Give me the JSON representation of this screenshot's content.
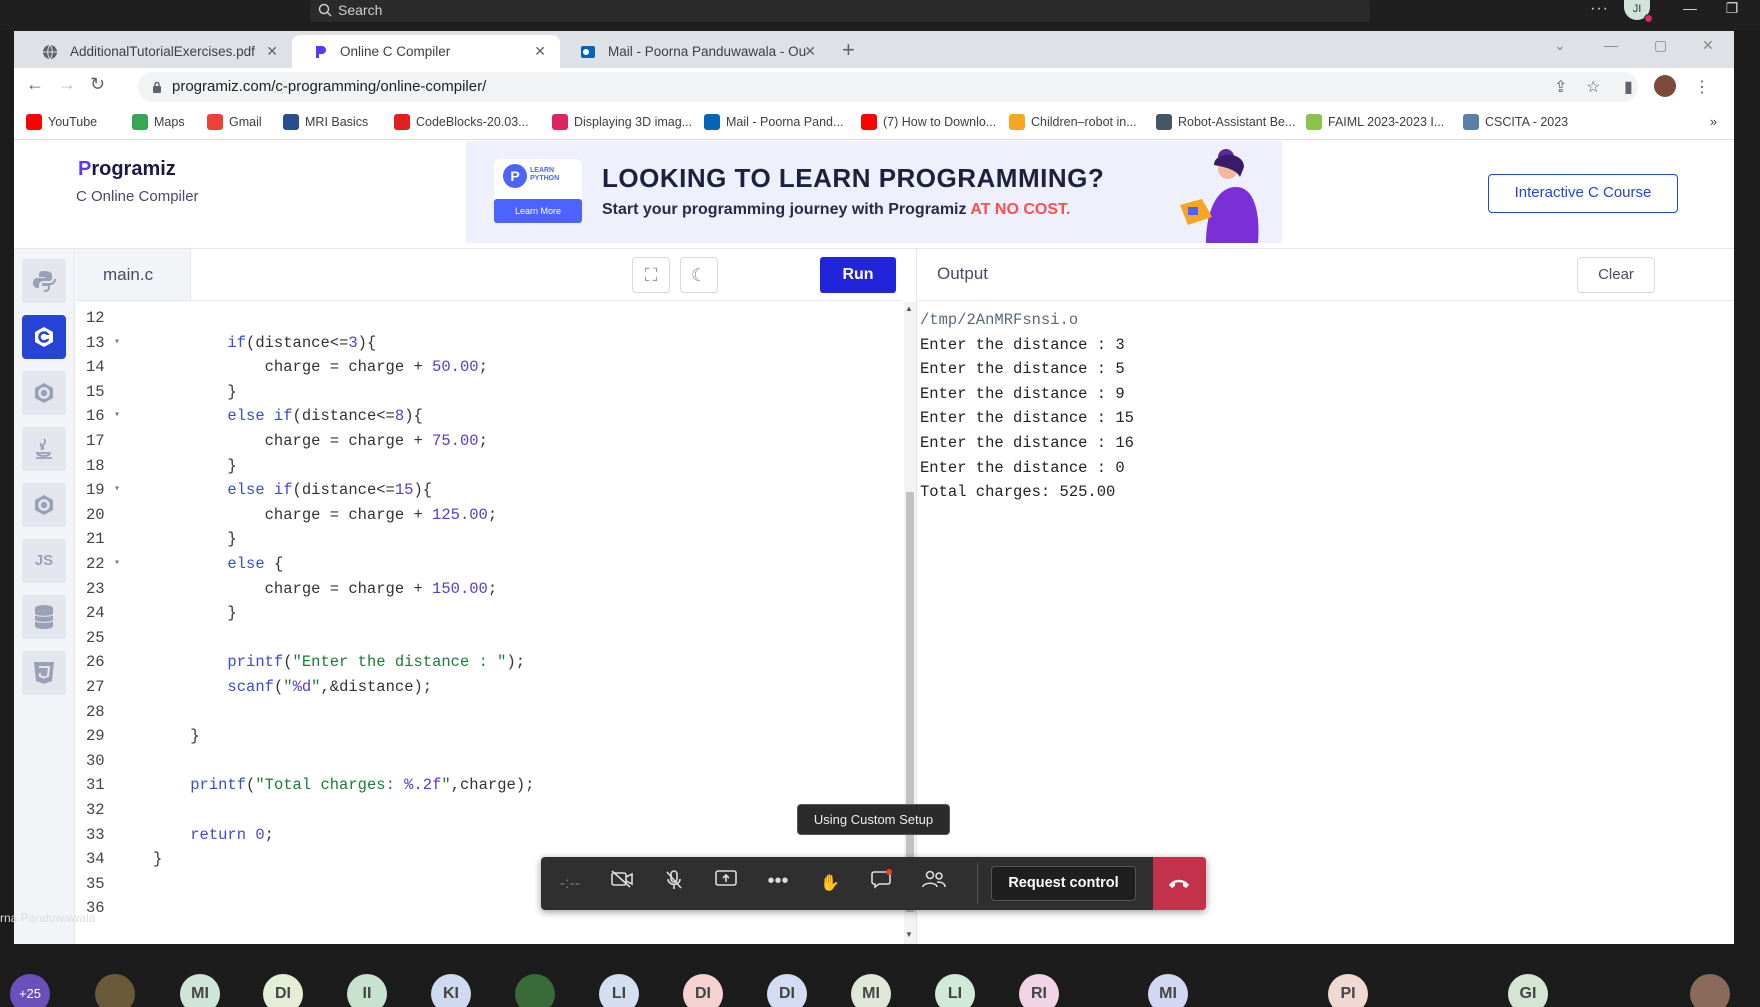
{
  "teams": {
    "search_placeholder": "Search",
    "more_label": "···",
    "user_initials": "JI"
  },
  "browser": {
    "tabs": [
      {
        "title": "AdditionalTutorialExercises.pdf",
        "close": "✕"
      },
      {
        "title": "Online C Compiler",
        "close": "✕"
      },
      {
        "title": "Mail - Poorna Panduwawala - Ou",
        "close": "✕"
      }
    ],
    "new_tab": "+",
    "url": "programiz.com/c-programming/online-compiler/",
    "bookmarks": [
      {
        "label": "YouTube",
        "color": "#ff0000"
      },
      {
        "label": "Maps",
        "color": "#34a853"
      },
      {
        "label": "Gmail",
        "color": "#ea4335"
      },
      {
        "label": "MRI Basics",
        "color": "#2a4d8f"
      },
      {
        "label": "CodeBlocks-20.03...",
        "color": "#e02020"
      },
      {
        "label": "Displaying 3D imag...",
        "color": "#e0245e"
      },
      {
        "label": "Mail - Poorna Pand...",
        "color": "#0364b8"
      },
      {
        "label": "(7) How to Downlo...",
        "color": "#ff0000"
      },
      {
        "label": "Children–robot in...",
        "color": "#f5a623"
      },
      {
        "label": "Robot-Assistant Be...",
        "color": "#445566"
      },
      {
        "label": "FAIML 2023-2023 I...",
        "color": "#8bc34a"
      },
      {
        "label": "CSCITA - 2023",
        "color": "#5b7fa8"
      }
    ],
    "bookmarks_more": "»"
  },
  "site": {
    "logo_p": "P",
    "logo_rest": "rogramiz",
    "subtitle": "C Online Compiler",
    "banner": {
      "tile_text_1": "LEARN",
      "tile_text_2": "PYTHON",
      "tile_button": "Learn More",
      "headline": "LOOKING TO LEARN PROGRAMMING?",
      "subline": "Start your programming journey with Programiz ",
      "subline_highlight": "AT NO COST."
    },
    "course_button": "Interactive C Course",
    "langs": [
      "py",
      "C",
      "C++",
      "Java",
      "C#",
      "JS",
      "SQL",
      "HTML"
    ]
  },
  "editor": {
    "file_tab": "main.c",
    "run_label": "Run",
    "lines": [
      {
        "n": "12",
        "f": "",
        "c": ""
      },
      {
        "n": "13",
        "f": "▾",
        "c": "        <span class='kw'>if</span>(distance&lt;=<span class='nm'>3</span>){"
      },
      {
        "n": "14",
        "f": "",
        "c": "            charge = charge + <span class='nm'>50.00</span>;"
      },
      {
        "n": "15",
        "f": "",
        "c": "        }"
      },
      {
        "n": "16",
        "f": "▾",
        "c": "        <span class='kw'>else if</span>(distance&lt;=<span class='nm'>8</span>){"
      },
      {
        "n": "17",
        "f": "",
        "c": "            charge = charge + <span class='nm'>75.00</span>;"
      },
      {
        "n": "18",
        "f": "",
        "c": "        }"
      },
      {
        "n": "19",
        "f": "▾",
        "c": "        <span class='kw'>else if</span>(distance&lt;=<span class='nm'>15</span>){"
      },
      {
        "n": "20",
        "f": "",
        "c": "            charge = charge + <span class='nm'>125.00</span>;"
      },
      {
        "n": "21",
        "f": "",
        "c": "        }"
      },
      {
        "n": "22",
        "f": "▾",
        "c": "        <span class='kw'>else</span> {"
      },
      {
        "n": "23",
        "f": "",
        "c": "            charge = charge + <span class='nm'>150.00</span>;"
      },
      {
        "n": "24",
        "f": "",
        "c": "        }"
      },
      {
        "n": "25",
        "f": "",
        "c": ""
      },
      {
        "n": "26",
        "f": "",
        "c": "        <span class='kw'>printf</span>(<span class='st'>\"Enter the distance : \"</span>);"
      },
      {
        "n": "27",
        "f": "",
        "c": "        <span class='kw'>scanf</span>(<span class='st'>\"<span class='nm'>%d</span>\"</span>,&amp;distance);"
      },
      {
        "n": "28",
        "f": "",
        "c": ""
      },
      {
        "n": "29",
        "f": "",
        "c": "    }"
      },
      {
        "n": "30",
        "f": "",
        "c": ""
      },
      {
        "n": "31",
        "f": "",
        "c": "    <span class='kw'>printf</span>(<span class='st'>\"Total charges: <span class='nm'>%.2f</span>\"</span>,charge);"
      },
      {
        "n": "32",
        "f": "",
        "c": ""
      },
      {
        "n": "33",
        "f": "",
        "c": "    <span class='kw'>return</span> <span class='nm'>0</span>;"
      },
      {
        "n": "34",
        "f": "",
        "c": "}"
      },
      {
        "n": "35",
        "f": "",
        "c": ""
      },
      {
        "n": "36",
        "f": "",
        "c": ""
      }
    ]
  },
  "output": {
    "title": "Output",
    "clear_label": "Clear",
    "lines": [
      "/tmp/2AnMRFsnsi.o",
      "Enter the distance : 3",
      "Enter the distance : 5",
      "Enter the distance : 9",
      "Enter the distance : 15",
      "Enter the distance : 16",
      "Enter the distance : 0",
      "Total charges: 525.00"
    ]
  },
  "call": {
    "tooltip": "Using Custom Setup",
    "request_control": "Request control",
    "speaker_name": "rna Panduwawala",
    "more_count": "+25",
    "participants": [
      {
        "initials": "",
        "color": "#6b5a3a"
      },
      {
        "initials": "MI",
        "color": "#cfe5d9"
      },
      {
        "initials": "DI",
        "color": "#e4edd5"
      },
      {
        "initials": "II",
        "color": "#c7e3cf"
      },
      {
        "initials": "KI",
        "color": "#cfd9ef"
      },
      {
        "initials": "",
        "color": "#3a6a3a"
      },
      {
        "initials": "LI",
        "color": "#d3dff0"
      },
      {
        "initials": "DI",
        "color": "#f4d2d2"
      },
      {
        "initials": "DI",
        "color": "#d3dcf2"
      },
      {
        "initials": "MI",
        "color": "#dfe8d8"
      },
      {
        "initials": "LI",
        "color": "#cfead9"
      },
      {
        "initials": "RI",
        "color": "#f1d3e6"
      },
      {
        "initials": "MI",
        "color": "#d3d8f2"
      },
      {
        "initials": "PI",
        "color": "#f0d9d2"
      },
      {
        "initials": "GI",
        "color": "#d4e5d4"
      }
    ]
  }
}
